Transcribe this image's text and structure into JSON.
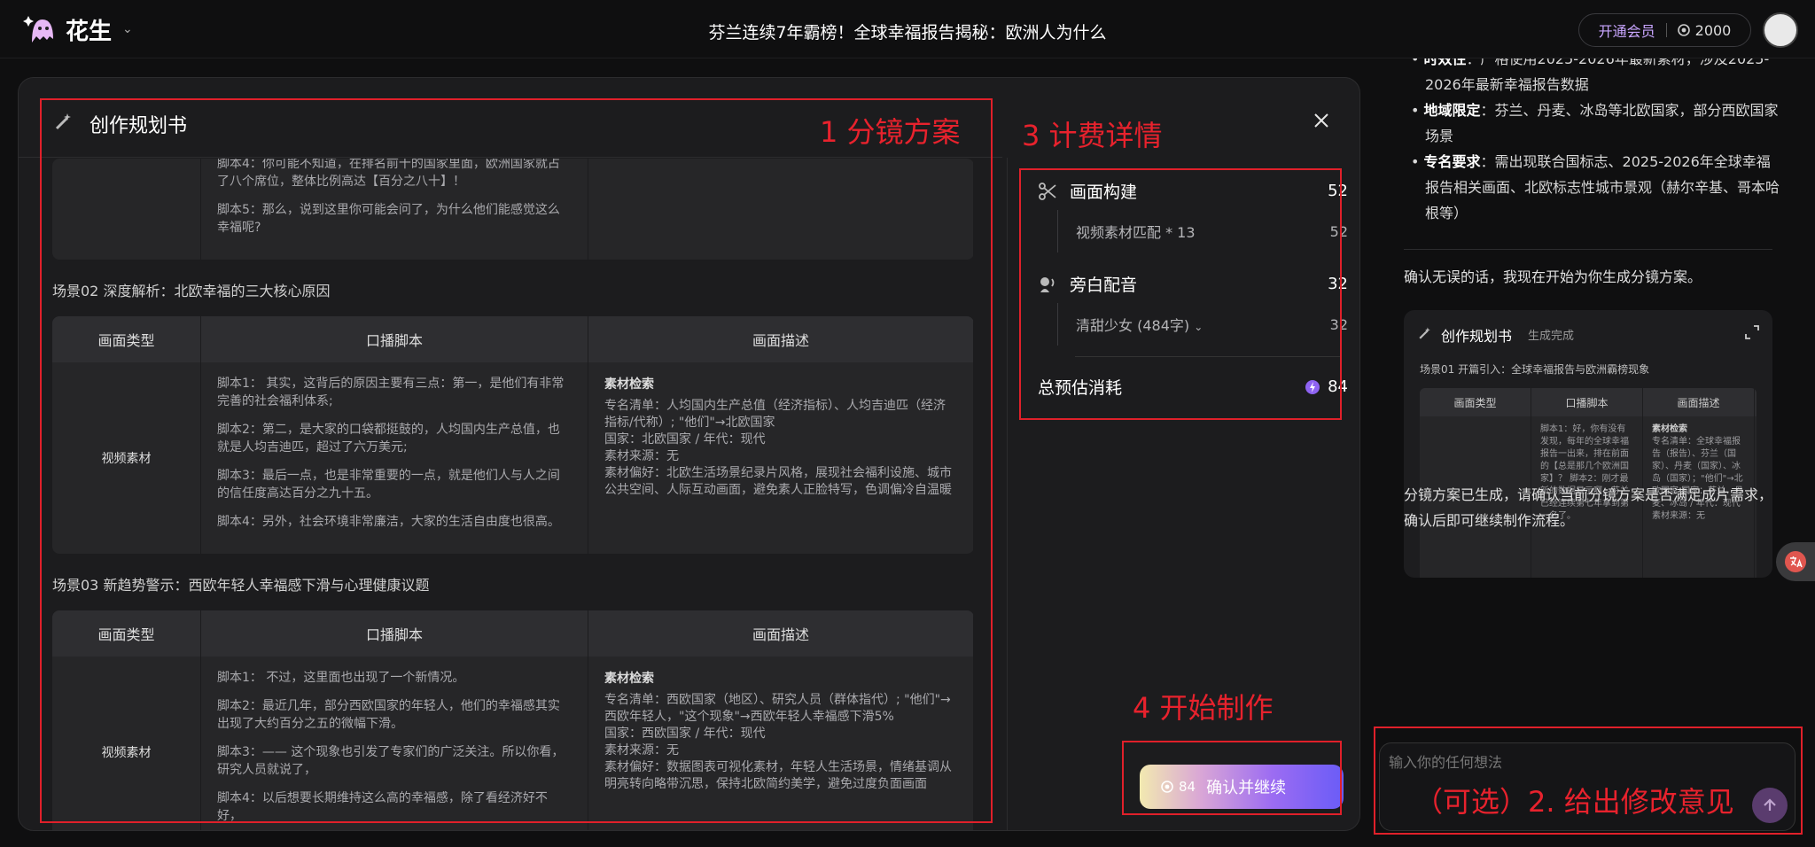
{
  "header": {
    "app_name": "花生",
    "title": "芬兰连续7年霸榜！全球幸福报告揭秘：欧洲人为什么",
    "vip_label": "开通会员",
    "credits": "2000"
  },
  "modal": {
    "title": "创作规划书",
    "scene1_tail": {
      "lines": [
        "脚本4：你可能不知道，在排名前十的国家里面，欧洲国家就占了八个席位，整体比例高达【百分之八十】！",
        "脚本5：那么，说到这里你可能会问了，为什么他们能感觉这么幸福呢?"
      ]
    },
    "columns": [
      "画面类型",
      "口播脚本",
      "画面描述"
    ],
    "scenes": [
      {
        "title": "场景02 深度解析：北欧幸福的三大核心原因",
        "type": "视频素材",
        "script": [
          "脚本1： 其实，这背后的原因主要有三点：第一，是他们有非常完善的社会福利体系;",
          "脚本2：第二，是大家的口袋都挺鼓的，人均国内生产总值，也就是人均吉迪匹，超过了六万美元;",
          "脚本3：最后一点，也是非常重要的一点，就是他们人与人之间的信任度高达百分之九十五。",
          "脚本4：另外，社会环境非常廉洁，大家的生活自由度也很高。"
        ],
        "desc_heading": "素材检索",
        "desc": [
          "专名清单：人均国内生产总值（经济指标）、人均吉迪匹（经济指标/代称）; \"他们\"→北欧国家",
          "国家：北欧国家 / 年代：现代",
          "素材来源：无",
          "素材偏好：北欧生活场景纪录片风格，展现社会福利设施、城市公共空间、人际互动画面，避免素人正脸特写，色调偏冷自温暖"
        ]
      },
      {
        "title": "场景03 新趋势警示：西欧年轻人幸福感下滑与心理健康议题",
        "type": "视频素材",
        "script": [
          "脚本1： 不过，这里面也出现了一个新情况。",
          "脚本2：最近几年，部分西欧国家的年轻人，他们的幸福感其实出现了大约百分之五的微幅下滑。",
          "脚本3：—— 这个现象也引发了专家们的广泛关注。所以你看，研究人员就说了，",
          "脚本4：以后想要长期维持这么高的幸福感，除了看经济好不好，"
        ],
        "desc_heading": "素材检索",
        "desc": [
          "专名清单：西欧国家（地区）、研究人员（群体指代）; \"他们\"→西欧年轻人，\"这个现象\"→西欧年轻人幸福感下滑5%",
          "国家：西欧国家 / 年代：现代",
          "素材来源：无",
          "素材偏好：数据图表可视化素材，年轻人生活场景，情绪基调从明亮转向略带沉思，保持北欧简约美学，避免过度负面画面"
        ]
      }
    ]
  },
  "billing": {
    "items": [
      {
        "label": "画面构建",
        "value": "52",
        "sub_label": "视频素材匹配 * 13",
        "sub_value": "52"
      },
      {
        "label": "旁白配音",
        "value": "32",
        "sub_label": "清甜少女 (484字)",
        "sub_value": "32"
      }
    ],
    "total_label": "总预估消耗",
    "total_value": "84"
  },
  "confirm": {
    "cost": "84",
    "label": "确认并继续"
  },
  "chat": {
    "bullets": [
      {
        "key": "时效性",
        "text": "：严格使用2025-2026年最新素材，涉及2025-2026年最新幸福报告数据"
      },
      {
        "key": "地域限定",
        "text": "：芬兰、丹麦、冰岛等北欧国家，部分西欧国家场景"
      },
      {
        "key": "专名要求",
        "text": "：需出现联合国标志、2025-2026年全球幸福报告相关画面、北欧标志性城市景观（赫尔辛基、哥本哈根等）"
      }
    ],
    "confirm_text": "确认无误的话，我现在开始为你生成分镜方案。",
    "card": {
      "title": "创作规划书",
      "status": "生成完成",
      "scene": "场景01 开篇引入：全球幸福报告与欧洲霸榜现象",
      "columns": [
        "画面类型",
        "口播脚本",
        "画面描述"
      ],
      "script": "脚本1：好，你有没有发现，每年的全球幸福报告一出来，排在前面的【总是那几个欧洲国家】？ 脚本2：刚才最新的数据显示啊，芬兰已经连续第七年拿到第一名了。",
      "desc_heading": "素材检索",
      "desc": "专名清单：全球幸福报告（报告）、芬兰（国家）、丹麦（国家）、冰岛（国家）；\"他们\"→北欧国家 国家：芬兰、丹麦、冰岛 / 年代：现代 素材来源：无"
    },
    "done_text": "分镜方案已生成，请确认当前分镜方案是否满足成片需求，确认后即可继续制作流程。",
    "input_placeholder": "输入你的任何想法"
  },
  "annotations": {
    "a1": "1 分镜方案",
    "a3": "3 计费详情",
    "a4": "4 开始制作",
    "a2": "（可选）2. 给出修改意见"
  },
  "colors": {
    "annotation": "#e0202a",
    "accent": "#9c6cf2"
  }
}
